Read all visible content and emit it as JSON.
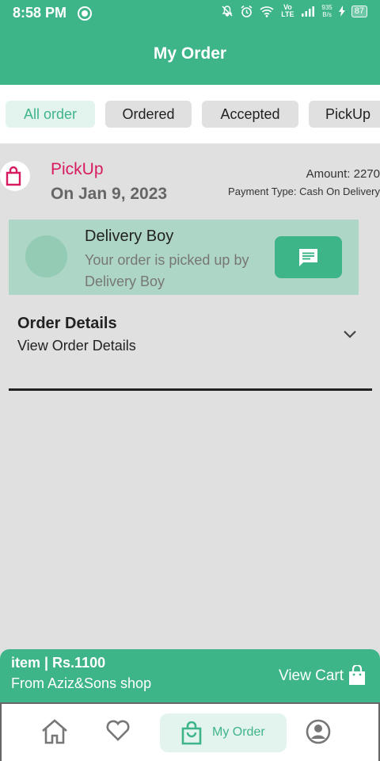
{
  "status_bar": {
    "time": "8:58 PM",
    "network_label": "Vo LTE",
    "net_speed_value": "935",
    "net_speed_unit": "B/s",
    "battery": "87"
  },
  "header": {
    "title": "My Order"
  },
  "tabs": [
    {
      "label": "All order",
      "active": true
    },
    {
      "label": "Ordered",
      "active": false
    },
    {
      "label": "Accepted",
      "active": false
    },
    {
      "label": "PickUp",
      "active": false
    }
  ],
  "order": {
    "status": "PickUp",
    "date": "On Jan 9, 2023",
    "amount": "Amount: 2270",
    "payment_type": "Payment Type: Cash On Delivery",
    "delivery": {
      "title": "Delivery Boy",
      "message": "Your order is picked up by Delivery Boy"
    },
    "details": {
      "title": "Order Details",
      "subtitle": "View Order Details"
    }
  },
  "cart": {
    "item": "item | Rs.1100",
    "shop": "From Aziz&Sons shop",
    "button_label": "View Cart"
  },
  "bottom_nav": {
    "items": [
      {
        "icon": "home-icon"
      },
      {
        "icon": "heart-icon"
      },
      {
        "icon": "shopping-bag-icon",
        "label": "My Order",
        "active": true
      },
      {
        "icon": "profile-icon"
      }
    ]
  },
  "colors": {
    "primary": "#3eb489",
    "status_pink": "#d81b60",
    "delivery_bg": "#aed6c6",
    "background": "#e0e0e0"
  }
}
